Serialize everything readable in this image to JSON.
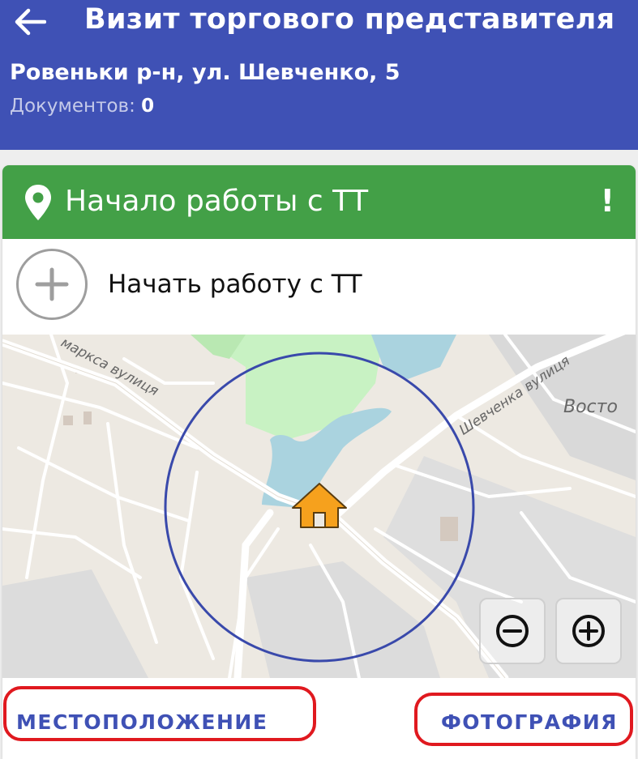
{
  "header": {
    "title": "Визит торгового представителя",
    "address": "Ровеньки р-н, ул. Шевченко, 5",
    "documents_label": "Документов:",
    "documents_count": "0",
    "color": "#3f51b5"
  },
  "card": {
    "title": "Начало работы с ТТ",
    "alert": "!",
    "color": "#43a047",
    "start_action": "Начать работу с ТТ"
  },
  "map": {
    "street_labels": [
      "маркса вулиця",
      "Шевченка вулиця",
      "Восто"
    ],
    "zoom_out_icon": "minus-circle-icon",
    "zoom_in_icon": "plus-circle-icon",
    "marker_icon": "home-icon"
  },
  "actions": {
    "location": "МЕСТОПОЛОЖЕНИЕ",
    "photo": "ФОТОГРАФИЯ"
  }
}
